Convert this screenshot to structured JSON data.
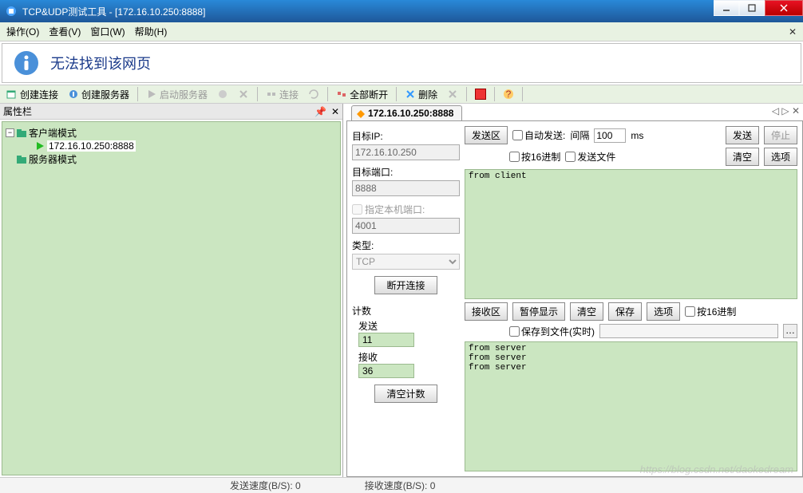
{
  "window": {
    "title": "TCP&UDP测试工具 - [172.16.10.250:8888]"
  },
  "menu": {
    "operate": "操作(O)",
    "view": "查看(V)",
    "window": "窗口(W)",
    "help": "帮助(H)"
  },
  "banner": {
    "text": "无法找到该网页"
  },
  "toolbar": {
    "create_conn": "创建连接",
    "create_server": "创建服务器",
    "start_server": "启动服务器",
    "connect": "连接",
    "disconnect_all": "全部断开",
    "delete": "删除"
  },
  "left_panel": {
    "title": "属性栏",
    "client_mode": "客户端模式",
    "connection": "172.16.10.250:8888",
    "server_mode": "服务器模式"
  },
  "tab": {
    "label": "172.16.10.250:8888",
    "nav": "◁ ▷ ✕"
  },
  "form": {
    "target_ip_label": "目标IP:",
    "target_ip": "172.16.10.250",
    "target_port_label": "目标端口:",
    "target_port": "8888",
    "local_port_label": "指定本机端口:",
    "local_port": "4001",
    "type_label": "类型:",
    "type": "TCP",
    "disconnect": "断开连接",
    "stats_label": "计数",
    "send_label": "发送",
    "send_count": "11",
    "recv_label": "接收",
    "recv_count": "36",
    "clear_stats": "清空计数"
  },
  "send": {
    "area_label": "发送区",
    "auto_send": "自动发送:",
    "interval_label": "间隔",
    "interval": "100",
    "ms": "ms",
    "send_btn": "发送",
    "stop_btn": "停止",
    "hex": "按16进制",
    "send_file": "发送文件",
    "clear": "清空",
    "options": "选项",
    "content": "from client"
  },
  "recv": {
    "area_label": "接收区",
    "pause": "暂停显示",
    "clear": "清空",
    "save": "保存",
    "options": "选项",
    "hex": "按16进制",
    "save_to_file": "保存到文件(实时)",
    "content": "from server\nfrom server\nfrom server"
  },
  "status": {
    "send_speed": "发送速度(B/S): 0",
    "recv_speed": "接收速度(B/S): 0"
  },
  "watermark": "https://blog.csdn.net/daokedream"
}
